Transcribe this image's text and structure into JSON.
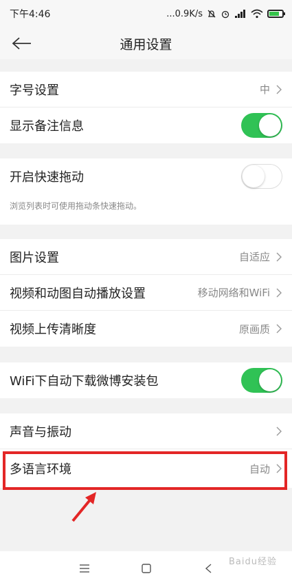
{
  "status": {
    "time": "下午4:46",
    "speed": "...0.9K/s"
  },
  "header": {
    "title": "通用设置"
  },
  "groups": {
    "g1": {
      "font_size": {
        "label": "字号设置",
        "value": "中"
      },
      "remark": {
        "label": "显示备注信息",
        "on": true
      }
    },
    "g2": {
      "quick_drag": {
        "label": "开启快速拖动",
        "on": false
      },
      "hint": "浏览列表时可使用拖动条快速拖动。"
    },
    "g3": {
      "image": {
        "label": "图片设置",
        "value": "自适应"
      },
      "video_auto": {
        "label": "视频和动图自动播放设置",
        "value": "移动网络和WiFi"
      },
      "video_upload": {
        "label": "视频上传清晰度",
        "value": "原画质"
      }
    },
    "g4": {
      "wifi_download": {
        "label": "WiFi下自动下载微博安装包",
        "on": true
      }
    },
    "g5": {
      "sound": {
        "label": "声音与振动",
        "value": ""
      },
      "language": {
        "label": "多语言环境",
        "value": "自动"
      }
    }
  },
  "colors": {
    "toggle_on": "#30c255",
    "highlight": "#e32626",
    "battery": "#35c24a"
  },
  "battery_level": 0.8,
  "watermark": "Baidu经验"
}
